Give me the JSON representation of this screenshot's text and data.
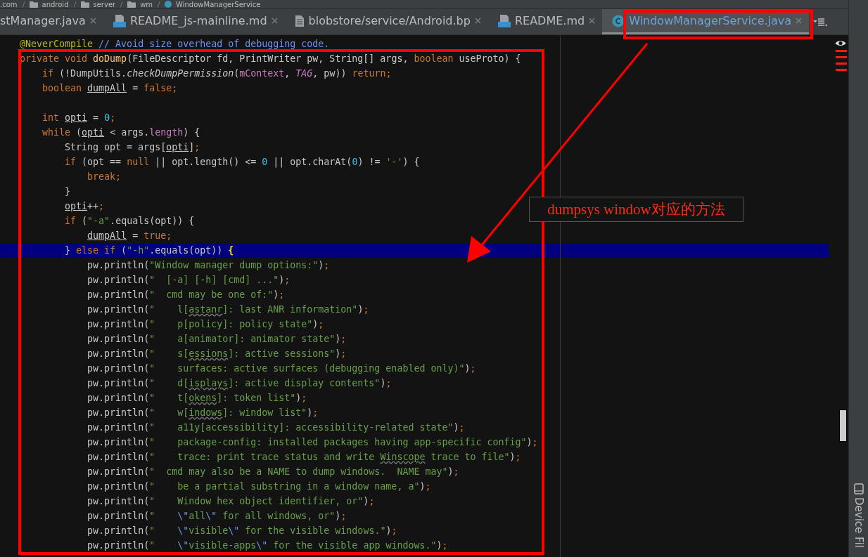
{
  "breadcrumb": [
    {
      "label": ".com",
      "kind": "text"
    },
    {
      "label": "android",
      "kind": "folder"
    },
    {
      "label": "server",
      "kind": "folder"
    },
    {
      "label": "wm",
      "kind": "folder"
    },
    {
      "label": "WindowManagerService",
      "kind": "class"
    }
  ],
  "tabs": [
    {
      "label": "stManager.java",
      "kind": "plain",
      "selected": false
    },
    {
      "label": "README_js-mainline.md",
      "kind": "md",
      "selected": false
    },
    {
      "label": "blobstore/service/Android.bp",
      "kind": "file",
      "selected": false
    },
    {
      "label": "README.md",
      "kind": "md",
      "selected": false
    },
    {
      "label": "WindowManagerService.java",
      "kind": "class",
      "selected": true
    }
  ],
  "editor": {
    "lines": [
      {
        "highlighted": false,
        "tokens": [
          {
            "kind": "annotation",
            "text": "@NeverCompile"
          },
          {
            "kind": "comment",
            "text": " // Avoid size overhead of debugging code."
          }
        ]
      },
      {
        "highlighted": false,
        "tokens": [
          {
            "kind": "kw",
            "text": "private void "
          },
          {
            "kind": "method",
            "text": "doDump"
          },
          {
            "kind": "plain",
            "text": "(FileDescriptor fd, PrintWriter pw, String[] args, "
          },
          {
            "kind": "kw",
            "text": "boolean"
          },
          {
            "kind": "plain",
            "text": " useProto) {"
          }
        ]
      },
      {
        "highlighted": false,
        "tokens": [
          {
            "kind": "kw",
            "text": "    if"
          },
          {
            "kind": "plain",
            "text": " (!DumpUtils."
          },
          {
            "kind": "static",
            "text": "checkDumpPermission"
          },
          {
            "kind": "plain",
            "text": "("
          },
          {
            "kind": "field",
            "text": "mContext"
          },
          {
            "kind": "plain",
            "text": ", "
          },
          {
            "kind": "staticfield",
            "text": "TAG"
          },
          {
            "kind": "plain",
            "text": ", pw)) "
          },
          {
            "kind": "kw",
            "text": "return;"
          }
        ]
      },
      {
        "highlighted": false,
        "tokens": [
          {
            "kind": "kw",
            "text": "    boolean "
          },
          {
            "kind": "var",
            "text": "dumpAll"
          },
          {
            "kind": "plain",
            "text": " = "
          },
          {
            "kind": "kw",
            "text": "false;"
          }
        ]
      },
      {
        "highlighted": false
      },
      {
        "highlighted": false,
        "tokens": [
          {
            "kind": "kw",
            "text": "    int "
          },
          {
            "kind": "var",
            "text": "opti"
          },
          {
            "kind": "plain",
            "text": " = "
          },
          {
            "kind": "num",
            "text": "0"
          },
          {
            "kind": "kw",
            "text": ";"
          }
        ]
      },
      {
        "highlighted": false,
        "tokens": [
          {
            "kind": "kw",
            "text": "    while "
          },
          {
            "kind": "plain",
            "text": "("
          },
          {
            "kind": "var",
            "text": "opti"
          },
          {
            "kind": "plain",
            "text": " < args."
          },
          {
            "kind": "field",
            "text": "length"
          },
          {
            "kind": "plain",
            "text": ") {"
          }
        ]
      },
      {
        "highlighted": false,
        "tokens": [
          {
            "kind": "plain",
            "text": "        String opt = args["
          },
          {
            "kind": "var",
            "text": "opti"
          },
          {
            "kind": "plain",
            "text": "]"
          },
          {
            "kind": "kw",
            "text": ";"
          }
        ]
      },
      {
        "highlighted": false,
        "tokens": [
          {
            "kind": "kw",
            "text": "        if "
          },
          {
            "kind": "plain",
            "text": "(opt == "
          },
          {
            "kind": "kw",
            "text": "null "
          },
          {
            "kind": "plain",
            "text": "|| opt.length() <= "
          },
          {
            "kind": "num",
            "text": "0"
          },
          {
            "kind": "plain",
            "text": " || opt.charAt("
          },
          {
            "kind": "num",
            "text": "0"
          },
          {
            "kind": "plain",
            "text": ") != "
          },
          {
            "kind": "str",
            "text": "'-'"
          },
          {
            "kind": "plain",
            "text": ") {"
          }
        ]
      },
      {
        "highlighted": false,
        "tokens": [
          {
            "kind": "kw",
            "text": "            break;"
          }
        ]
      },
      {
        "highlighted": false,
        "tokens": [
          {
            "kind": "plain",
            "text": "        }"
          }
        ]
      },
      {
        "highlighted": false,
        "tokens": [
          {
            "kind": "var",
            "text": "        opti"
          },
          {
            "kind": "plain",
            "text": "++"
          },
          {
            "kind": "kw",
            "text": ";"
          }
        ]
      },
      {
        "highlighted": false,
        "tokens": [
          {
            "kind": "kw",
            "text": "        if "
          },
          {
            "kind": "plain",
            "text": "("
          },
          {
            "kind": "str",
            "text": "\"-a\""
          },
          {
            "kind": "plain",
            "text": ".equals(opt)) {"
          }
        ]
      },
      {
        "highlighted": false,
        "tokens": [
          {
            "kind": "var",
            "text": "            dumpAll"
          },
          {
            "kind": "plain",
            "text": " = "
          },
          {
            "kind": "kw",
            "text": "true;"
          }
        ]
      },
      {
        "highlighted": true,
        "tokens": [
          {
            "kind": "plain",
            "text": "        } "
          },
          {
            "kind": "kw",
            "text": "else if "
          },
          {
            "kind": "plain",
            "text": "("
          },
          {
            "kind": "str",
            "text": "\"-h\""
          },
          {
            "kind": "plain",
            "text": ".equals(opt)) "
          },
          {
            "kind": "brace",
            "text": "{"
          }
        ]
      },
      {
        "highlighted": false,
        "tokens": [
          {
            "kind": "plain",
            "text": "            pw.println("
          },
          {
            "kind": "str",
            "text": "\"Window manager dump options:\""
          },
          {
            "kind": "plain",
            "text": ")"
          },
          {
            "kind": "kw",
            "text": ";"
          }
        ]
      },
      {
        "highlighted": false,
        "tokens": [
          {
            "kind": "plain",
            "text": "            pw.println("
          },
          {
            "kind": "str",
            "text": "\"  [-a] [-h] [cmd] ...\""
          },
          {
            "kind": "plain",
            "text": ")"
          },
          {
            "kind": "kw",
            "text": ";"
          }
        ]
      },
      {
        "highlighted": false,
        "tokens": [
          {
            "kind": "plain",
            "text": "            pw.println("
          },
          {
            "kind": "str",
            "text": "\"  cmd may be one of:\""
          },
          {
            "kind": "plain",
            "text": ")"
          },
          {
            "kind": "kw",
            "text": ";"
          }
        ]
      },
      {
        "highlighted": false,
        "tokens": [
          {
            "kind": "plain",
            "text": "            pw.println("
          },
          {
            "kind": "str",
            "text": "\"    l["
          },
          {
            "kind": "typo",
            "text": "astanr"
          },
          {
            "kind": "str",
            "text": "]: last ANR information\""
          },
          {
            "kind": "plain",
            "text": ")"
          },
          {
            "kind": "kw",
            "text": ";"
          }
        ]
      },
      {
        "highlighted": false,
        "tokens": [
          {
            "kind": "plain",
            "text": "            pw.println("
          },
          {
            "kind": "str",
            "text": "\"    p[policy]: policy state\""
          },
          {
            "kind": "plain",
            "text": ")"
          },
          {
            "kind": "kw",
            "text": ";"
          }
        ]
      },
      {
        "highlighted": false,
        "tokens": [
          {
            "kind": "plain",
            "text": "            pw.println("
          },
          {
            "kind": "str",
            "text": "\"    a[animator]: animator state\""
          },
          {
            "kind": "plain",
            "text": ")"
          },
          {
            "kind": "kw",
            "text": ";"
          }
        ]
      },
      {
        "highlighted": false,
        "tokens": [
          {
            "kind": "plain",
            "text": "            pw.println("
          },
          {
            "kind": "str",
            "text": "\"    s["
          },
          {
            "kind": "typo",
            "text": "essions"
          },
          {
            "kind": "str",
            "text": "]: active sessions\""
          },
          {
            "kind": "plain",
            "text": ")"
          },
          {
            "kind": "kw",
            "text": ";"
          }
        ]
      },
      {
        "highlighted": false,
        "tokens": [
          {
            "kind": "plain",
            "text": "            pw.println("
          },
          {
            "kind": "str",
            "text": "\"    surfaces: active surfaces (debugging enabled only)\""
          },
          {
            "kind": "plain",
            "text": ")"
          },
          {
            "kind": "kw",
            "text": ";"
          }
        ]
      },
      {
        "highlighted": false,
        "tokens": [
          {
            "kind": "plain",
            "text": "            pw.println("
          },
          {
            "kind": "str",
            "text": "\"    d["
          },
          {
            "kind": "typo",
            "text": "isplays"
          },
          {
            "kind": "str",
            "text": "]: active display contents\""
          },
          {
            "kind": "plain",
            "text": ")"
          },
          {
            "kind": "kw",
            "text": ";"
          }
        ]
      },
      {
        "highlighted": false,
        "tokens": [
          {
            "kind": "plain",
            "text": "            pw.println("
          },
          {
            "kind": "str",
            "text": "\"    t["
          },
          {
            "kind": "typo",
            "text": "okens"
          },
          {
            "kind": "str",
            "text": "]: token list\""
          },
          {
            "kind": "plain",
            "text": ")"
          },
          {
            "kind": "kw",
            "text": ";"
          }
        ]
      },
      {
        "highlighted": false,
        "tokens": [
          {
            "kind": "plain",
            "text": "            pw.println("
          },
          {
            "kind": "str",
            "text": "\"    w["
          },
          {
            "kind": "typo",
            "text": "indows"
          },
          {
            "kind": "str",
            "text": "]: window list\""
          },
          {
            "kind": "plain",
            "text": ")"
          },
          {
            "kind": "kw",
            "text": ";"
          }
        ]
      },
      {
        "highlighted": false,
        "tokens": [
          {
            "kind": "plain",
            "text": "            pw.println("
          },
          {
            "kind": "str",
            "text": "\"    a11y[accessibility]: accessibility-related state\""
          },
          {
            "kind": "plain",
            "text": ")"
          },
          {
            "kind": "kw",
            "text": ";"
          }
        ]
      },
      {
        "highlighted": false,
        "tokens": [
          {
            "kind": "plain",
            "text": "            pw.println("
          },
          {
            "kind": "str",
            "text": "\"    package-config: installed packages having app-specific config\""
          },
          {
            "kind": "plain",
            "text": ")"
          },
          {
            "kind": "kw",
            "text": ";"
          }
        ]
      },
      {
        "highlighted": false,
        "tokens": [
          {
            "kind": "plain",
            "text": "            pw.println("
          },
          {
            "kind": "str",
            "text": "\"    trace: print trace status and write "
          },
          {
            "kind": "typo",
            "text": "Winscope"
          },
          {
            "kind": "str",
            "text": " trace to file\""
          },
          {
            "kind": "plain",
            "text": ")"
          },
          {
            "kind": "kw",
            "text": ";"
          }
        ]
      },
      {
        "highlighted": false,
        "tokens": [
          {
            "kind": "plain",
            "text": "            pw.println("
          },
          {
            "kind": "str",
            "text": "\"  cmd may also be a NAME to dump windows.  NAME may\""
          },
          {
            "kind": "plain",
            "text": ")"
          },
          {
            "kind": "kw",
            "text": ";"
          }
        ]
      },
      {
        "highlighted": false,
        "tokens": [
          {
            "kind": "plain",
            "text": "            pw.println("
          },
          {
            "kind": "str",
            "text": "\"    be a partial substring in a window name, a\""
          },
          {
            "kind": "plain",
            "text": ")"
          },
          {
            "kind": "kw",
            "text": ";"
          }
        ]
      },
      {
        "highlighted": false,
        "tokens": [
          {
            "kind": "plain",
            "text": "            pw.println("
          },
          {
            "kind": "str",
            "text": "\"    Window hex object identifier, or\""
          },
          {
            "kind": "plain",
            "text": ")"
          },
          {
            "kind": "kw",
            "text": ";"
          }
        ]
      },
      {
        "highlighted": false,
        "tokens": [
          {
            "kind": "plain",
            "text": "            pw.println("
          },
          {
            "kind": "str",
            "text": "\"    "
          },
          {
            "kind": "esc",
            "text": "\\\""
          },
          {
            "kind": "str",
            "text": "all"
          },
          {
            "kind": "esc",
            "text": "\\\""
          },
          {
            "kind": "str",
            "text": " for all windows, or\""
          },
          {
            "kind": "plain",
            "text": ")"
          },
          {
            "kind": "kw",
            "text": ";"
          }
        ]
      },
      {
        "highlighted": false,
        "tokens": [
          {
            "kind": "plain",
            "text": "            pw.println("
          },
          {
            "kind": "str",
            "text": "\"    "
          },
          {
            "kind": "esc",
            "text": "\\\""
          },
          {
            "kind": "str",
            "text": "visible"
          },
          {
            "kind": "esc",
            "text": "\\\""
          },
          {
            "kind": "str",
            "text": " for the visible windows.\""
          },
          {
            "kind": "plain",
            "text": ")"
          },
          {
            "kind": "kw",
            "text": ";"
          }
        ]
      },
      {
        "highlighted": false,
        "tokens": [
          {
            "kind": "plain",
            "text": "            pw.println("
          },
          {
            "kind": "str",
            "text": "\"    "
          },
          {
            "kind": "esc",
            "text": "\\\""
          },
          {
            "kind": "str",
            "text": "visible-apps"
          },
          {
            "kind": "esc",
            "text": "\\\""
          },
          {
            "kind": "str",
            "text": " for the visible app windows.\""
          },
          {
            "kind": "plain",
            "text": ")"
          },
          {
            "kind": "kw",
            "text": ";"
          }
        ]
      }
    ]
  },
  "side_panel": {
    "label": "Device Fil"
  },
  "annotation": {
    "label": "dumpsys window对应的方法"
  }
}
